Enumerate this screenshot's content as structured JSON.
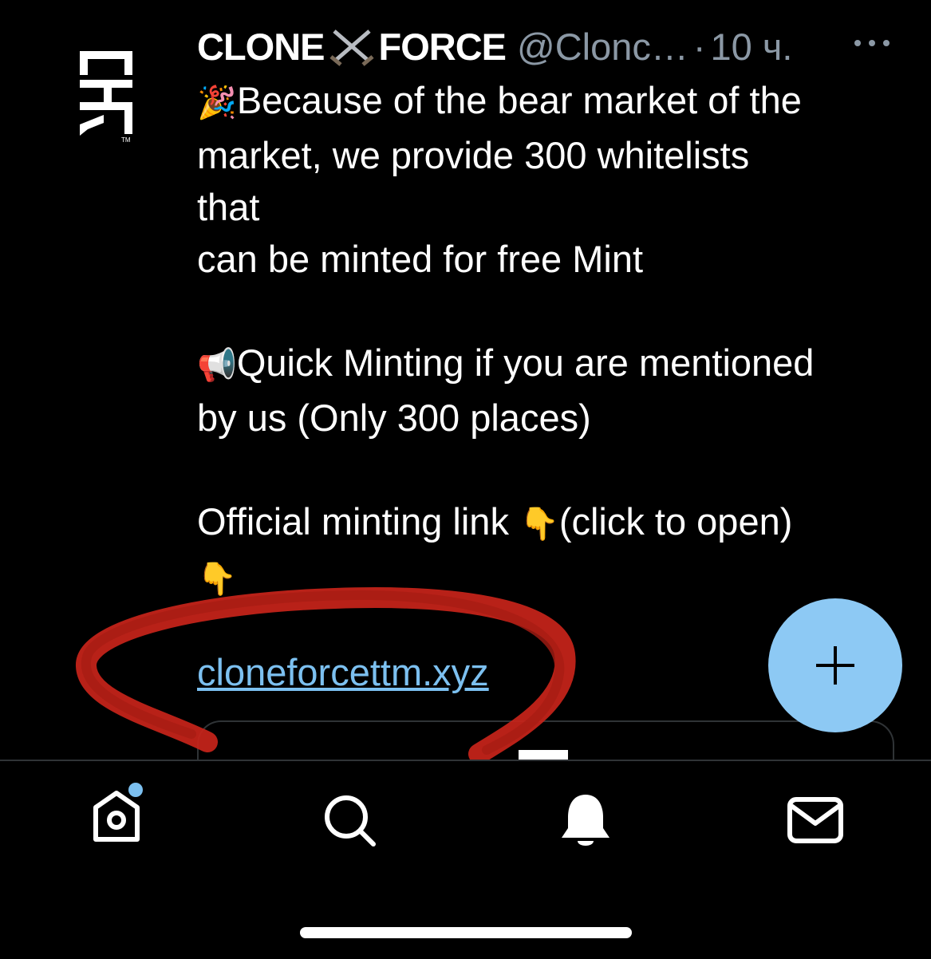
{
  "tweet": {
    "author_name_part1": "CLONE",
    "author_name_part2": "FORCE",
    "handle": "@Clonc…",
    "separator": "·",
    "time": "10 ч.",
    "lines": [
      {
        "emoji": "🎉",
        "text": "Because of the bear market of the\nmarket, we provide 300 whitelists\nthat\ncan be minted for free Mint\n\n"
      },
      {
        "emoji": "📢",
        "text": "Quick Minting if you are mentioned\nby us (Only 300 places)\n\n"
      },
      {
        "text": "Official minting link "
      },
      {
        "emoji": "👇",
        "text": "(click to open)\n"
      },
      {
        "emoji": "👇",
        "text": ""
      }
    ],
    "link": "cloneforcettm.xyz"
  },
  "colors": {
    "background": "#000000",
    "link": "#7cc0f0",
    "fab": "#8dc9f4",
    "muted": "#8b98a5",
    "annotation": "#c8241a",
    "notification_dot": "#7cc0f0"
  },
  "icons": {
    "avatar": "cloneforce-logo-icon",
    "name_separator": "crossed-swords-icon",
    "more": "more-horizontal-icon",
    "fab": "plus-icon",
    "tabs": [
      "home-icon",
      "search-icon",
      "bell-icon",
      "mail-icon"
    ]
  }
}
